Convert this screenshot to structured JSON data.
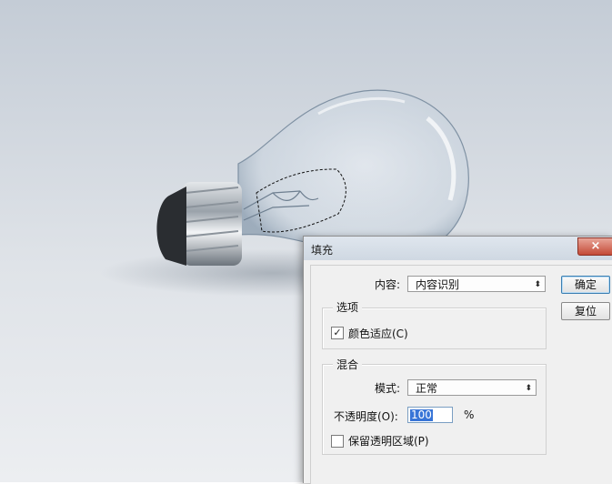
{
  "colors": {
    "background_top": "#c6ced8",
    "background_bottom": "#eef0f3",
    "accent": "#3875d7"
  },
  "dialog": {
    "title": "填充",
    "close_icon": "×",
    "content_label": "内容:",
    "content_value": "内容识别",
    "ok_label": "确定",
    "reset_label": "复位",
    "options_legend": "选项",
    "color_adapt_label": "颜色适应(C)",
    "color_adapt_checked": true,
    "check_mark": "✓",
    "blend_legend": "混合",
    "mode_label": "模式:",
    "mode_value": "正常",
    "opacity_label": "不透明度(O):",
    "opacity_value": "100",
    "opacity_unit": "%",
    "preserve_label": "保留透明区域(P)",
    "preserve_checked": false,
    "dropdown_icon": "⬍"
  }
}
